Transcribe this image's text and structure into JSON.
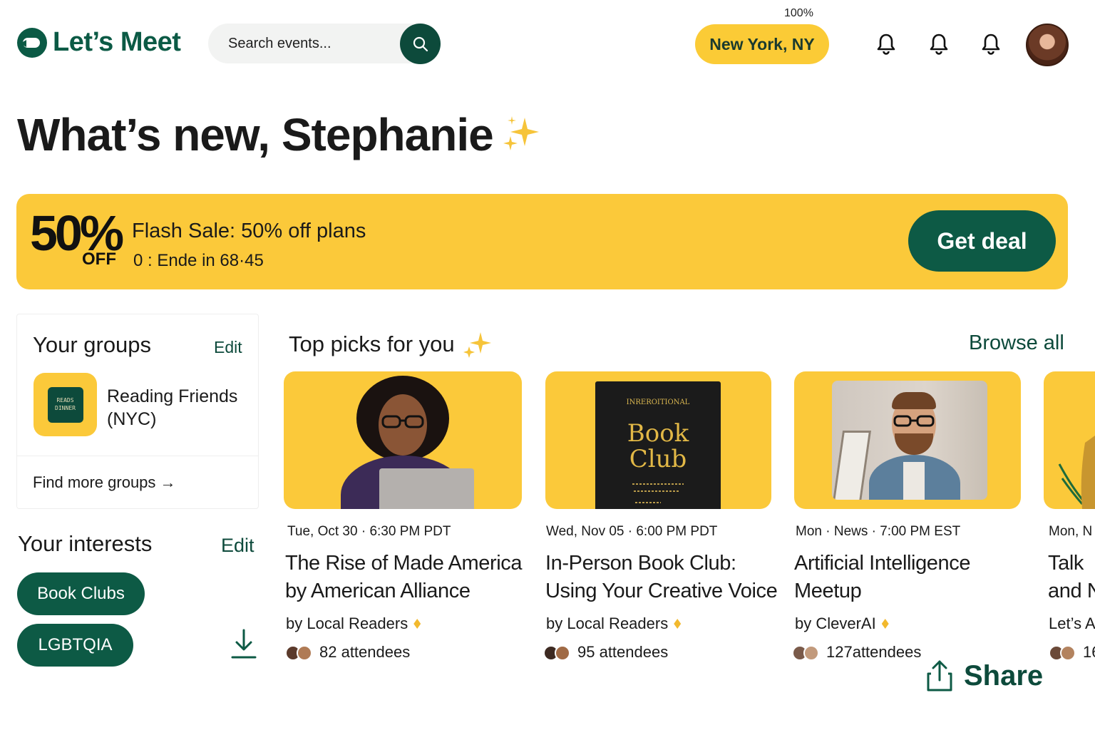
{
  "header": {
    "logo_text": "Let’s Meet",
    "search_placeholder": "Search events...",
    "zoom": "100%",
    "location": "New York, NY"
  },
  "greeting": "What’s new, Stephanie",
  "promo": {
    "percent": "50%",
    "off": "OFF",
    "title": "Flash Sale: 50% off plans",
    "timer": "0 : Ende in 68·45",
    "cta": "Get deal"
  },
  "groups": {
    "title": "Your groups",
    "edit": "Edit",
    "items": [
      {
        "name": "Reading Friends (NYC)",
        "thumb_text": "READS DINNER"
      }
    ],
    "find_more": "Find more groups →"
  },
  "interests": {
    "title": "Your interests",
    "edit": "Edit",
    "chips": [
      "Book Clubs",
      "LGBTQIA"
    ]
  },
  "picks": {
    "title": "Top picks for you",
    "browse_all": "Browse all",
    "events": [
      {
        "meta": "Tue, Oct 30 · 6:30 PM PDT",
        "title_line1": "The Rise of Made America",
        "title_line2": "by American Alliance",
        "host": "by Local Readers",
        "attendees": "82 attendees"
      },
      {
        "meta": "Wed, Nov 05 · 6:00 PM PDT",
        "title_line1": "In-Person Book Club:",
        "title_line2": "Using Your Creative Voice",
        "host": "by Local Readers",
        "attendees": "95 attendees",
        "book_small": "INREROITIONAL",
        "book_title_1": "Book",
        "book_title_2": "Club"
      },
      {
        "meta": "Mon · News · 7:00 PM EST",
        "title_line1": "Artificial Intelligence",
        "title_line2": "Meetup",
        "host": "by CleverAI",
        "attendees": "127attendees"
      },
      {
        "meta": "Mon, N",
        "title_line1": "Talk",
        "title_line2": "and N",
        "host": "Let’s A",
        "attendees": "16"
      }
    ]
  },
  "share": "Share",
  "colors": {
    "brand_green": "#0d5a45",
    "accent_yellow": "#fbc93a"
  }
}
